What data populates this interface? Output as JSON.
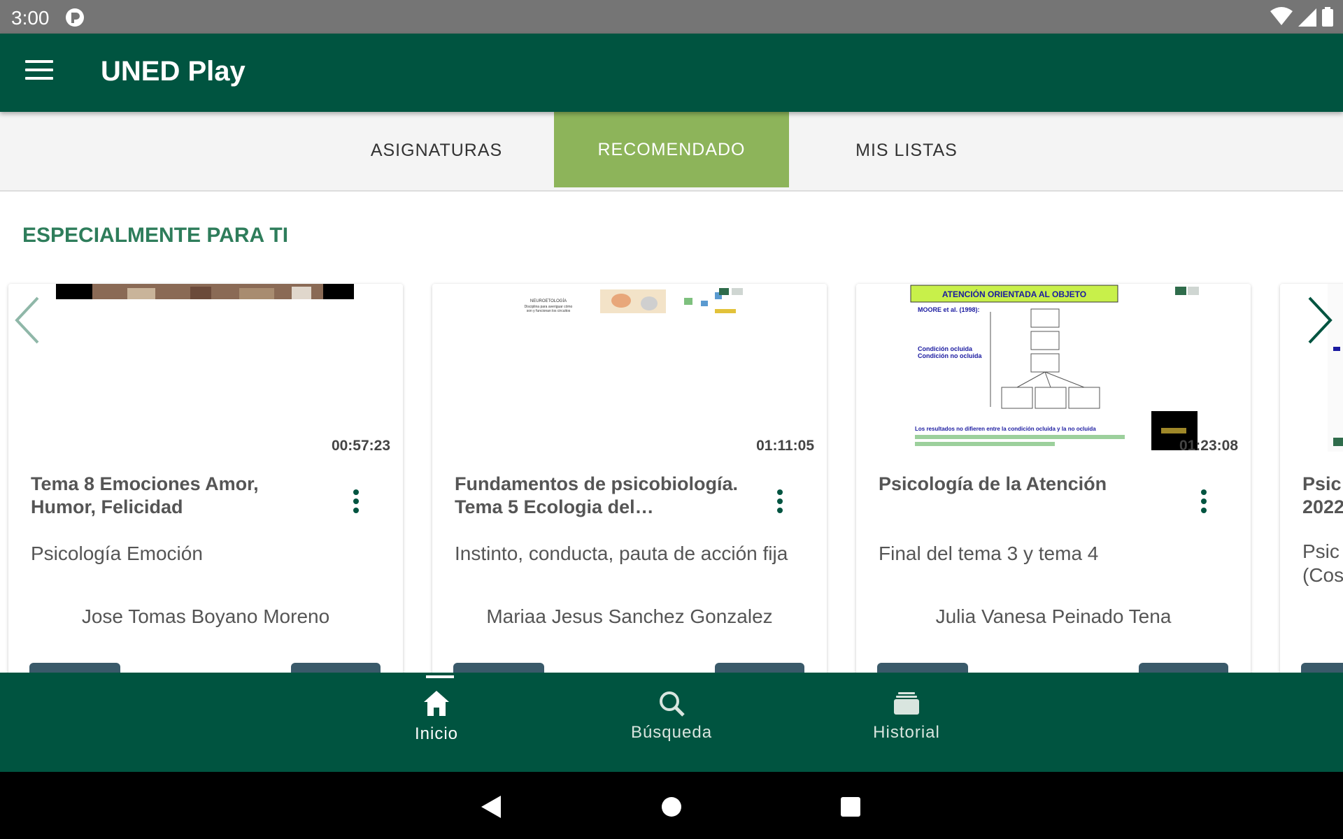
{
  "status_bar": {
    "time": "3:00"
  },
  "app_bar": {
    "title": "UNED Play"
  },
  "tabs": [
    {
      "label": "ASIGNATURAS"
    },
    {
      "label": "RECOMENDADO"
    },
    {
      "label": "MIS LISTAS"
    }
  ],
  "selected_tab": "RECOMENDADO",
  "section": {
    "title": "ESPECIALMENTE PARA TI"
  },
  "cards": [
    {
      "duration": "00:57:23",
      "title": "Tema 8 Emociones Amor, Humor, Felicidad",
      "description": "Psicología Emoción",
      "author": "Jose Tomas Boyano Moreno"
    },
    {
      "duration": "01:11:05",
      "title": "Fundamentos de psicobiología. Tema 5 Ecologia del…",
      "description": "Instinto, conducta, pauta de acción fija",
      "author": "Mariaa Jesus Sanchez Gonzalez"
    },
    {
      "duration": "01:23:08",
      "title": "Psicología de la Atención",
      "description": "Final del tema 3 y tema 4",
      "author": "Julia Vanesa Peinado Tena"
    },
    {
      "duration": "",
      "title": "Psic\n2022",
      "description": "Psic\n(Cos",
      "author": ""
    }
  ],
  "thumb3": {
    "banner": "ATENCIÓN ORIENTADA AL OBJETO",
    "ref": "MOORE et al. (1998):",
    "bullet1": "Condición ocluida",
    "bullet2": "Condición no ocluida",
    "footer": "Los resultados no difieren entre la condición ocluida y la no ocluida"
  },
  "thumb2": {
    "line1": "NEUROETOLOGÍA",
    "line2": "Disciplina para averiguar cómo",
    "line3": "son y funcionan los circuitos"
  },
  "bottom_nav": [
    {
      "label": "Inicio",
      "icon": "home-icon"
    },
    {
      "label": "Búsqueda",
      "icon": "search-icon"
    },
    {
      "label": "Historial",
      "icon": "history-icon"
    }
  ],
  "colors": {
    "app_bar": "#005440",
    "tab_active": "#8db45a",
    "section_title": "#2e7d5b"
  }
}
